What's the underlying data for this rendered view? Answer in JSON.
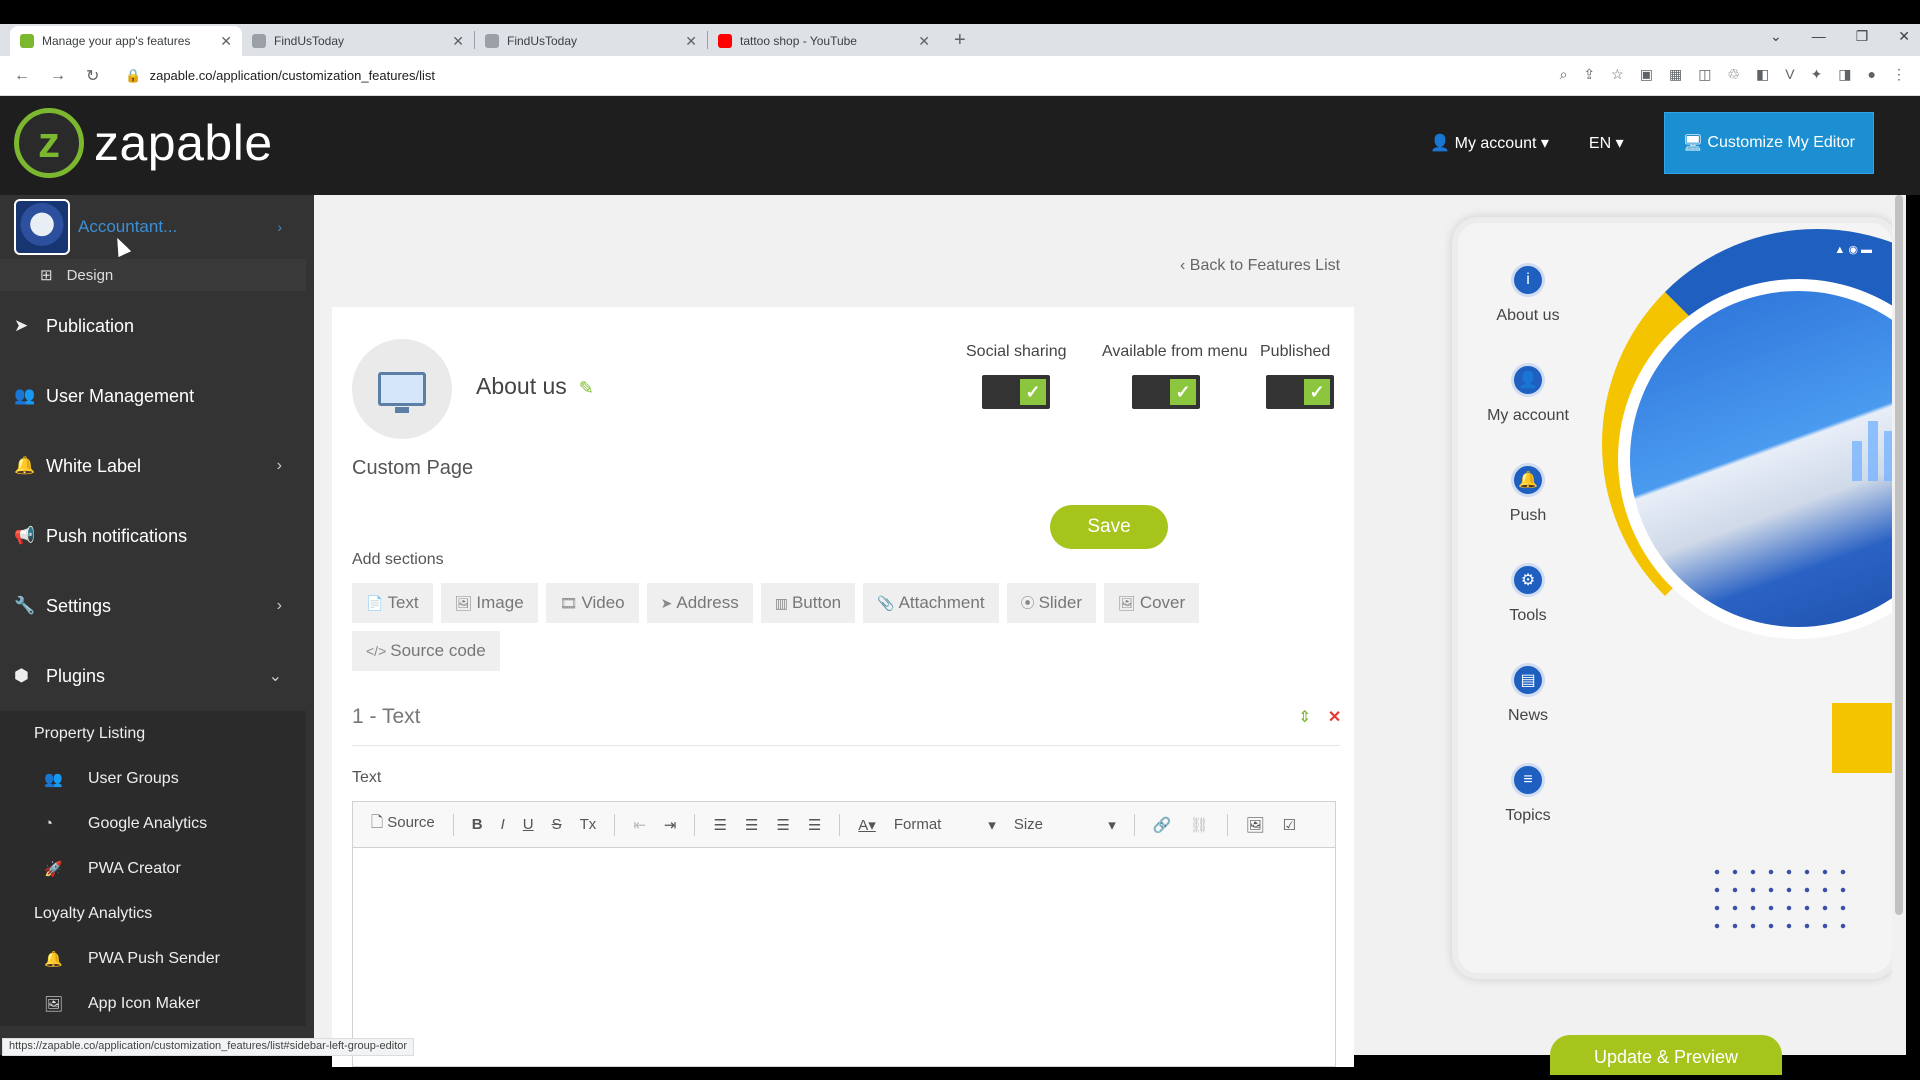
{
  "browser": {
    "tabs": [
      {
        "title": "Manage your app's features",
        "active": true,
        "favicon_color": "#7cb82f"
      },
      {
        "title": "FindUsToday",
        "active": false,
        "favicon_color": "#9aa0a6"
      },
      {
        "title": "FindUsToday",
        "active": false,
        "favicon_color": "#9aa0a6"
      },
      {
        "title": "tattoo shop - YouTube",
        "active": false,
        "favicon_color": "#ff0000"
      }
    ],
    "url": "zapable.co/application/customization_features/list",
    "status_url": "https://zapable.co/application/customization_features/list#sidebar-left-group-editor"
  },
  "header": {
    "logo_letter": "z",
    "logo_text": "zapable",
    "my_account": "My account",
    "language": "EN",
    "customize_button": "Customize My Editor"
  },
  "sidebar": {
    "app_name": "Accountant...",
    "design": "Design",
    "items": [
      {
        "label": "Publication",
        "icon": "paper-plane-icon",
        "glyph": "➤",
        "chevron": false
      },
      {
        "label": "User Management",
        "icon": "users-icon",
        "glyph": "👥",
        "chevron": false
      },
      {
        "label": "White Label",
        "icon": "bell-icon",
        "glyph": "🔔",
        "chevron": true
      },
      {
        "label": "Push notifications",
        "icon": "bullhorn-icon",
        "glyph": "📢",
        "chevron": false
      },
      {
        "label": "Settings",
        "icon": "wrench-icon",
        "glyph": "🔧",
        "chevron": true
      },
      {
        "label": "Plugins",
        "icon": "cubes-icon",
        "glyph": "⬢",
        "chevron": true
      }
    ],
    "plugins": [
      {
        "label": "Property Listing",
        "glyph": ""
      },
      {
        "label": "User Groups",
        "glyph": "👥"
      },
      {
        "label": "Google Analytics",
        "glyph": "◔"
      },
      {
        "label": "PWA Creator",
        "glyph": "🚀"
      },
      {
        "label": "Loyalty Analytics",
        "glyph": ""
      },
      {
        "label": "PWA Push Sender",
        "glyph": "🔔"
      },
      {
        "label": "App Icon Maker",
        "glyph": "🖼"
      }
    ]
  },
  "main": {
    "back_link": "Back to Features List",
    "feature_title": "About us",
    "feature_type": "Custom Page",
    "toggles": {
      "social_sharing": "Social sharing",
      "available_from_menu": "Available from menu",
      "published": "Published"
    },
    "save": "Save",
    "add_sections": "Add sections",
    "section_buttons": [
      {
        "label": "Text",
        "glyph": "📄"
      },
      {
        "label": "Image",
        "glyph": "🖼"
      },
      {
        "label": "Video",
        "glyph": "🎞"
      },
      {
        "label": "Address",
        "glyph": "➤"
      },
      {
        "label": "Button",
        "glyph": "▥"
      },
      {
        "label": "Attachment",
        "glyph": "📎"
      },
      {
        "label": "Slider",
        "glyph": "⦿"
      },
      {
        "label": "Cover",
        "glyph": "🖼"
      },
      {
        "label": "Source code",
        "glyph": "</>"
      }
    ],
    "section_title": "1 - Text",
    "text_label": "Text",
    "editor": {
      "source": "Source",
      "format": "Format",
      "size": "Size"
    }
  },
  "preview": {
    "menu": [
      "About us",
      "My account",
      "Push",
      "Tools",
      "News",
      "Topics"
    ],
    "update_button": "Update & Preview"
  },
  "colors": {
    "accent_green": "#a6c51c",
    "accent_blue": "#1b8fd1",
    "sidebar_bg": "#333333"
  }
}
